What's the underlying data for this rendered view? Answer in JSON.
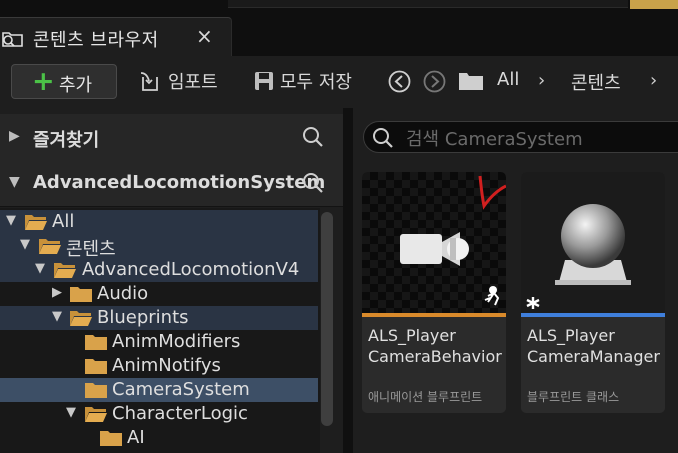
{
  "tab": {
    "title": "콘텐츠 브라우저",
    "close": "×"
  },
  "toolbar": {
    "add_label": "추가",
    "add_plus": "+",
    "import_label": "임포트",
    "save_all_label": "모두 저장",
    "breadcrumb": [
      "All",
      "콘텐츠"
    ]
  },
  "left": {
    "favorites": "즐겨찾기",
    "project": "AdvancedLocomotionSystem",
    "tree": [
      {
        "label": "All"
      },
      {
        "label": "콘텐츠"
      },
      {
        "label": "AdvancedLocomotionV4"
      },
      {
        "label": "Audio"
      },
      {
        "label": "Blueprints"
      },
      {
        "label": "AnimModifiers"
      },
      {
        "label": "AnimNotifys"
      },
      {
        "label": "CameraSystem"
      },
      {
        "label": "CharacterLogic"
      },
      {
        "label": "AI"
      }
    ]
  },
  "right": {
    "search_placeholder": "검색 CameraSystem",
    "assets": [
      {
        "line1": "ALS_Player",
        "line2": "CameraBehavior",
        "type": "애니메이션 블루프린트",
        "accent": "#d98a2b"
      },
      {
        "line1": "ALS_Player",
        "line2": "CameraManager",
        "type": "블루프린트 클래스",
        "accent": "#3f7fdc"
      }
    ]
  },
  "colors": {
    "selection": "#3d4f66",
    "highlight": "#2a3444",
    "add_plus": "#4bc247"
  }
}
